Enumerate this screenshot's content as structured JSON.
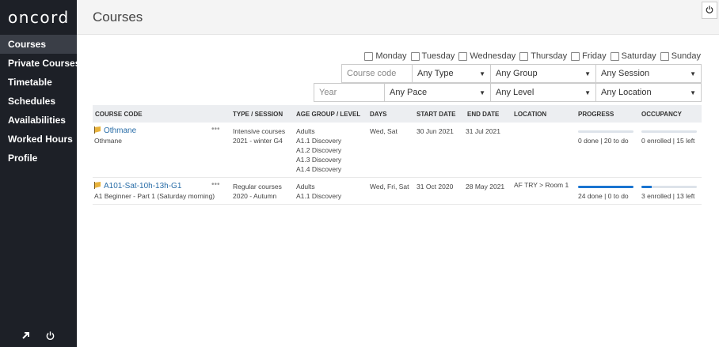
{
  "sidebar": {
    "logo": "oncord",
    "items": [
      {
        "label": "Courses",
        "active": true
      },
      {
        "label": "Private Courses"
      },
      {
        "label": "Timetable"
      },
      {
        "label": "Schedules"
      },
      {
        "label": "Availabilities"
      },
      {
        "label": "Worked Hours"
      },
      {
        "label": "Profile"
      }
    ],
    "footer_icons": [
      "external-link-icon",
      "power-icon"
    ]
  },
  "header": {
    "title": "Courses",
    "logout_icon": "power-icon"
  },
  "filters": {
    "days": [
      "Monday",
      "Tuesday",
      "Wednesday",
      "Thursday",
      "Friday",
      "Saturday",
      "Sunday"
    ],
    "course_code_placeholder": "Course code",
    "type": "Any Type",
    "group": "Any Group",
    "session": "Any Session",
    "year_placeholder": "Year",
    "pace": "Any Pace",
    "level": "Any Level",
    "location": "Any Location"
  },
  "table": {
    "headers": [
      "COURSE CODE",
      "TYPE / SESSION",
      "AGE GROUP / LEVEL",
      "DAYS",
      "START DATE",
      "END DATE",
      "LOCATION",
      "PROGRESS",
      "OCCUPANCY"
    ],
    "rows": [
      {
        "code": "Othmane",
        "subtitle": "Othmane",
        "type": "Intensive courses",
        "session": "2021 - winter G4",
        "age_group": "Adults",
        "levels": [
          "A1.1 Discovery",
          "A1.2 Discovery",
          "A1.3 Discovery",
          "A1.4 Discovery"
        ],
        "days": "Wed, Sat",
        "start": "30 Jun 2021",
        "end": "31 Jul 2021",
        "location": "",
        "progress_text": "0 done | 20 to do",
        "progress_fraction": 0,
        "occupancy_text": "0 enrolled | 15 left",
        "occupancy_fraction": 0
      },
      {
        "code": "A101-Sat-10h-13h-G1",
        "subtitle": "A1 Beginner - Part 1 (Saturday morning)",
        "type": "Regular courses",
        "session": "2020 - Autumn",
        "age_group": "Adults",
        "levels": [
          "A1.1 Discovery"
        ],
        "days": "Wed, Fri, Sat",
        "start": "31 Oct 2020",
        "end": "28 May 2021",
        "location": "AF TRY > Room 1",
        "progress_text": "24 done | 0 to do",
        "progress_fraction": 1,
        "occupancy_text": "3 enrolled | 13 left",
        "occupancy_fraction": 0.1875
      }
    ]
  },
  "colors": {
    "sidebar": "#1d2027",
    "active": "#3a3e47",
    "link": "#2a6ea8",
    "progress": "#1a74d0",
    "flag": "#e8b23a"
  }
}
